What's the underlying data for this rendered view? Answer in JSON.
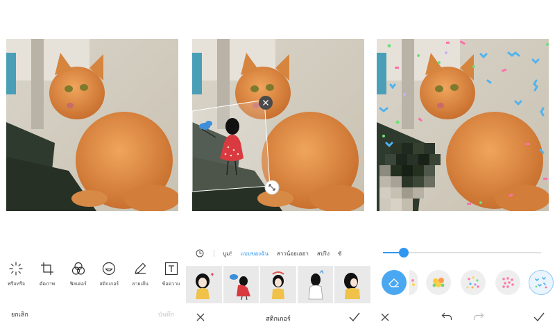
{
  "editor": {
    "tools": [
      {
        "label": "ฟรีจทรีจ",
        "icon": "magic-wand-icon"
      },
      {
        "label": "ตัดภาพ",
        "icon": "crop-icon"
      },
      {
        "label": "ฟิลเตอร์",
        "icon": "filter-icon"
      },
      {
        "label": "สติกเกอร์",
        "icon": "sticker-icon"
      },
      {
        "label": "ลายเส้น",
        "icon": "pen-icon"
      },
      {
        "label": "ข้อความ",
        "icon": "text-icon"
      }
    ],
    "cancel_label": "ยกเลิก",
    "save_label": "บันทึก"
  },
  "sticker_picker": {
    "tabs": [
      "บูม!",
      "แบบของฉัน",
      "สาวน้อยเฮฮา",
      "สปริง",
      "ซั"
    ],
    "active_tab_index": 1,
    "title": "สติกเกอร์",
    "stickers": [
      "girl-heart-sticker",
      "girl-cloud-sticker",
      "girl-arms-up-sticker",
      "girl-back-sticker",
      "girl-profile-sticker"
    ]
  },
  "mosaic_brush": {
    "level": 0.13,
    "brushes": [
      "eraser",
      "partial-flower",
      "flower-bouquet",
      "dot-confetti",
      "pink-dots",
      "blue-confetti"
    ],
    "selected_brush_index": 5
  },
  "colors": {
    "accent": "#2f97f0",
    "confetti_blue": "#4fb3ef",
    "confetti_pink": "#ff6ea8",
    "confetti_green": "#6ee07c"
  }
}
